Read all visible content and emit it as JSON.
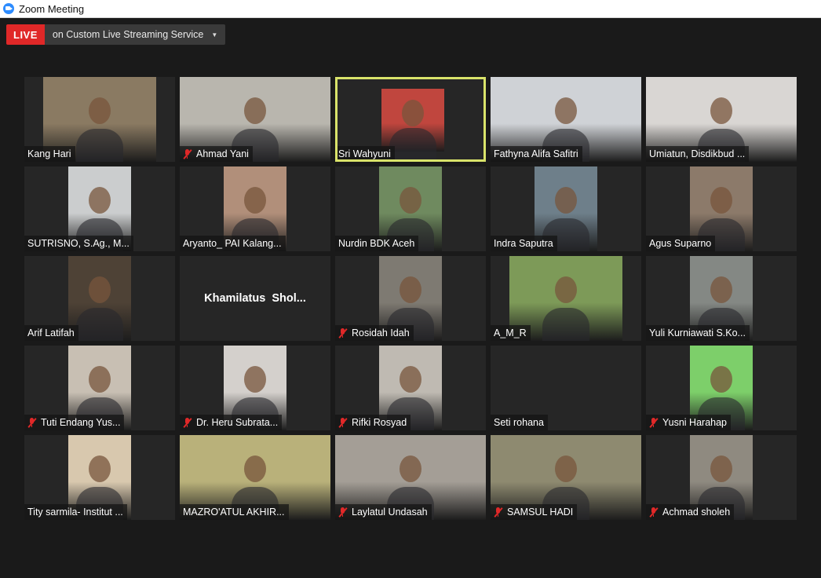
{
  "window": {
    "title": "Zoom Meeting"
  },
  "live": {
    "badge": "LIVE",
    "service": "on Custom Live Streaming Service"
  },
  "participants": [
    {
      "name": "Kang Hari",
      "muted": false,
      "bg": "#8a7a62"
    },
    {
      "name": "Ahmad Yani",
      "muted": true,
      "bg": "#b9b6ae"
    },
    {
      "name": "Sri Wahyuni",
      "muted": false,
      "bg": "#c0463e",
      "active": true
    },
    {
      "name": "Fathyna Alifa Safitri",
      "muted": false,
      "bg": "#cfd2d6"
    },
    {
      "name": "Umiatun, Disdikbud ...",
      "muted": false,
      "bg": "#d9d6d3"
    },
    {
      "name": "SUTRISNO, S.Ag., M...",
      "muted": false,
      "bg": "#cbcdce"
    },
    {
      "name": "Aryanto_ PAI Kalang...",
      "muted": false,
      "bg": "#b18f7a"
    },
    {
      "name": "Nurdin BDK Aceh",
      "muted": false,
      "bg": "#6f8a5f"
    },
    {
      "name": "Indra Saputra",
      "muted": false,
      "bg": "#6e7f8a"
    },
    {
      "name": "Agus Suparno",
      "muted": false,
      "bg": "#8c7a6a"
    },
    {
      "name": "Arif Latifah",
      "muted": false,
      "bg": "#4e4236"
    },
    {
      "name": "Khamilatus  Shol...",
      "muted": false,
      "bg": "#262626",
      "noVideo": true
    },
    {
      "name": "Rosidah Idah",
      "muted": true,
      "bg": "#7e7a72"
    },
    {
      "name": "A_M_R",
      "muted": false,
      "bg": "#7d9a58"
    },
    {
      "name": "Yuli Kurniawati S.Ko...",
      "muted": false,
      "bg": "#848884"
    },
    {
      "name": "Tuti Endang Yus...",
      "muted": true,
      "bg": "#c8bfb3"
    },
    {
      "name": "Dr. Heru Subrata...",
      "muted": true,
      "bg": "#d4d0cc"
    },
    {
      "name": "Rifki Rosyad",
      "muted": true,
      "bg": "#bfbab2"
    },
    {
      "name": "Seti rohana",
      "muted": false,
      "bg": "#262626",
      "blank": true
    },
    {
      "name": "Yusni Harahap",
      "muted": true,
      "bg": "#7dcf6a"
    },
    {
      "name": "Tity sarmila- Institut ...",
      "muted": false,
      "bg": "#d8c8ae"
    },
    {
      "name": "MAZRO'ATUL AKHIR...",
      "muted": false,
      "bg": "#b9b17a"
    },
    {
      "name": "Laylatul Undasah",
      "muted": true,
      "bg": "#a49e96"
    },
    {
      "name": "SAMSUL HADI",
      "muted": true,
      "bg": "#8e8a70"
    },
    {
      "name": "Achmad sholeh",
      "muted": true,
      "bg": "#8f8a80"
    }
  ]
}
